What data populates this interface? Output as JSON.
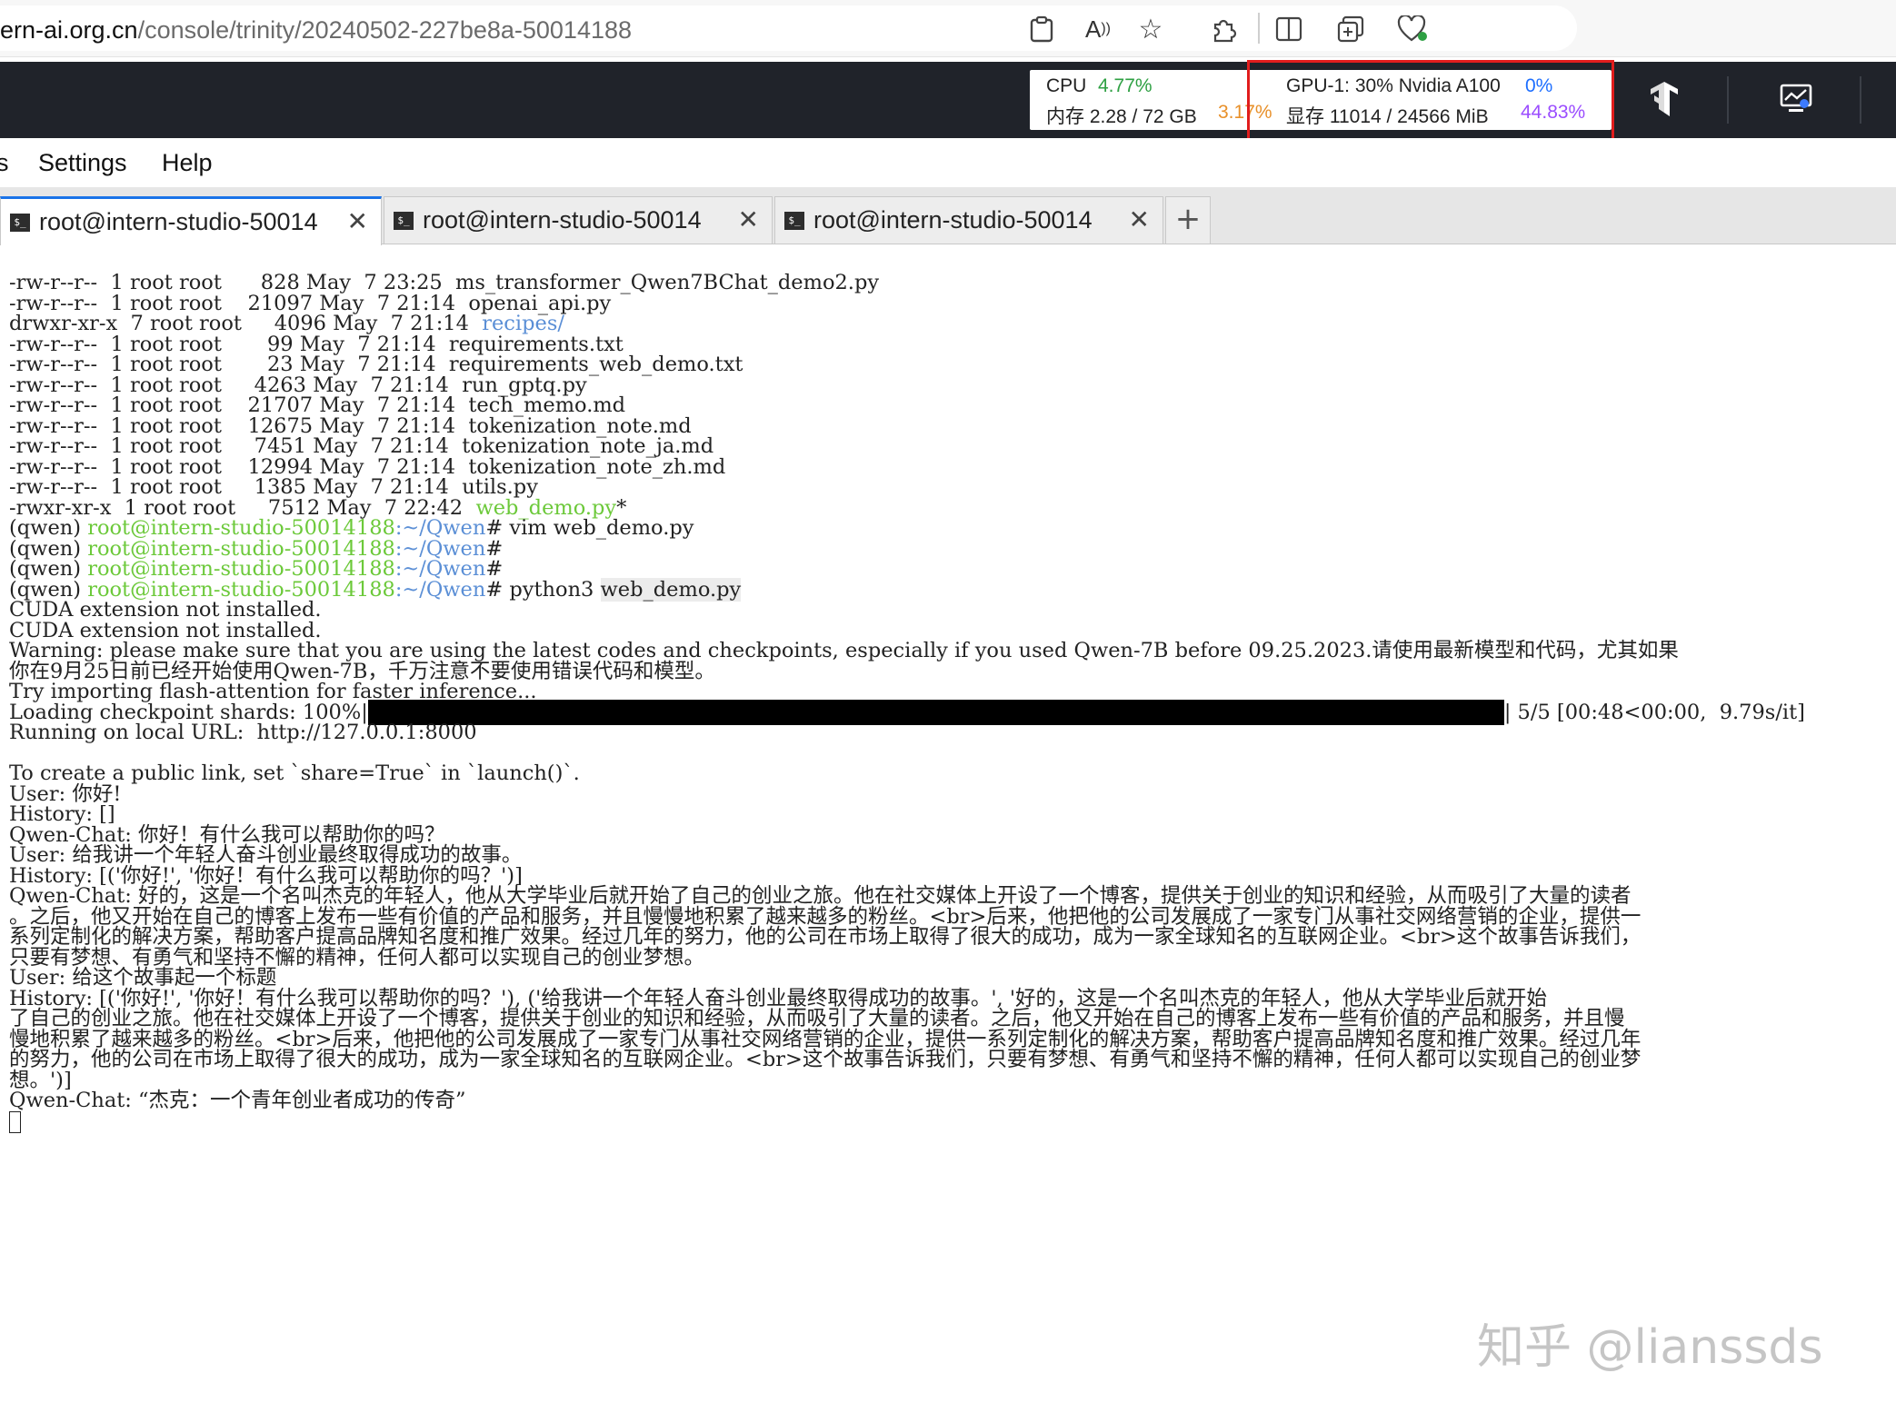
{
  "browser": {
    "url_host": "ern-ai.org.cn",
    "url_path": "/console/trinity/20240502-227be8a-50014188"
  },
  "header": {
    "cpu_label": "CPU",
    "cpu_value": "4.77%",
    "mem_label": "内存 2.28 / 72 GB",
    "mem_value": "3.17%",
    "gpu_label": "GPU-1: 30% Nvidia A100",
    "gpu_value": "0%",
    "vram_label": "显存 11014 / 24566 MiB",
    "vram_value": "44.83%"
  },
  "menubar": {
    "items": [
      "s",
      "Settings",
      "Help"
    ]
  },
  "tabs": [
    {
      "label": "root@intern-studio-50014",
      "active": true
    },
    {
      "label": "root@intern-studio-50014",
      "active": false
    },
    {
      "label": "root@intern-studio-50014",
      "active": false
    }
  ],
  "terminal": {
    "files": [
      {
        "perm": "-rw-r--r--",
        "links": "1",
        "owner": "root root",
        "size": "828",
        "month": "May",
        "day": "7",
        "time": "23:25",
        "name": "ms_transformer_Qwen7BChat_demo2.py",
        "kind": "file"
      },
      {
        "perm": "-rw-r--r--",
        "links": "1",
        "owner": "root root",
        "size": "21097",
        "month": "May",
        "day": "7",
        "time": "21:14",
        "name": "openai_api.py",
        "kind": "file"
      },
      {
        "perm": "drwxr-xr-x",
        "links": "7",
        "owner": "root root",
        "size": "4096",
        "month": "May",
        "day": "7",
        "time": "21:14",
        "name": "recipes/",
        "kind": "dir"
      },
      {
        "perm": "-rw-r--r--",
        "links": "1",
        "owner": "root root",
        "size": "99",
        "month": "May",
        "day": "7",
        "time": "21:14",
        "name": "requirements.txt",
        "kind": "file"
      },
      {
        "perm": "-rw-r--r--",
        "links": "1",
        "owner": "root root",
        "size": "23",
        "month": "May",
        "day": "7",
        "time": "21:14",
        "name": "requirements_web_demo.txt",
        "kind": "file"
      },
      {
        "perm": "-rw-r--r--",
        "links": "1",
        "owner": "root root",
        "size": "4263",
        "month": "May",
        "day": "7",
        "time": "21:14",
        "name": "run_gptq.py",
        "kind": "file"
      },
      {
        "perm": "-rw-r--r--",
        "links": "1",
        "owner": "root root",
        "size": "21707",
        "month": "May",
        "day": "7",
        "time": "21:14",
        "name": "tech_memo.md",
        "kind": "file"
      },
      {
        "perm": "-rw-r--r--",
        "links": "1",
        "owner": "root root",
        "size": "12675",
        "month": "May",
        "day": "7",
        "time": "21:14",
        "name": "tokenization_note.md",
        "kind": "file"
      },
      {
        "perm": "-rw-r--r--",
        "links": "1",
        "owner": "root root",
        "size": "7451",
        "month": "May",
        "day": "7",
        "time": "21:14",
        "name": "tokenization_note_ja.md",
        "kind": "file"
      },
      {
        "perm": "-rw-r--r--",
        "links": "1",
        "owner": "root root",
        "size": "12994",
        "month": "May",
        "day": "7",
        "time": "21:14",
        "name": "tokenization_note_zh.md",
        "kind": "file"
      },
      {
        "perm": "-rw-r--r--",
        "links": "1",
        "owner": "root root",
        "size": "1385",
        "month": "May",
        "day": "7",
        "time": "21:14",
        "name": "utils.py",
        "kind": "file"
      },
      {
        "perm": "-rwxr-xr-x",
        "links": "1",
        "owner": "root root",
        "size": "7512",
        "month": "May",
        "day": "7",
        "time": "22:42",
        "name": "web_demo.py",
        "kind": "exec",
        "suffix": "*"
      }
    ],
    "prompt_env": "(qwen) ",
    "prompt_user": "root@intern-studio-50014188",
    "prompt_path": ":~/Qwen",
    "prompt_hash": "#",
    "commands": [
      " vim web_demo.py",
      "",
      "",
      " python3 web_demo.py"
    ],
    "output": [
      "CUDA extension not installed.",
      "CUDA extension not installed.",
      "Warning: please make sure that you are using the latest codes and checkpoints, especially if you used Qwen-7B before 09.25.2023.请使用最新模型和代码，尤其如果",
      "你在9月25日前已经开始使用Qwen-7B，千万注意不要使用错误代码和模型。",
      "Try importing flash-attention for faster inference..."
    ],
    "loading_label": "Loading checkpoint shards: 100%|",
    "loading_progress": 1.0,
    "loading_tail": "| 5/5 [00:48<00:00,  9.79s/it]",
    "output2": [
      "Running on local URL:  http://127.0.0.1:8000",
      "",
      "To create a public link, set `share=True` in `launch()`.",
      "User: 你好!",
      "History: []",
      "Qwen-Chat: 你好！有什么我可以帮助你的吗？",
      "User: 给我讲一个年轻人奋斗创业最终取得成功的故事。",
      "History: [('你好!', '你好！有什么我可以帮助你的吗？')]",
      "Qwen-Chat: 好的，这是一个名叫杰克的年轻人，他从大学毕业后就开始了自己的创业之旅。他在社交媒体上开设了一个博客，提供关于创业的知识和经验，从而吸引了大量的读者",
      "。之后，他又开始在自己的博客上发布一些有价值的产品和服务，并且慢慢地积累了越来越多的粉丝。<br>后来，他把他的公司发展成了一家专门从事社交网络营销的企业，提供一",
      "系列定制化的解决方案，帮助客户提高品牌知名度和推广效果。经过几年的努力，他的公司在市场上取得了很大的成功，成为一家全球知名的互联网企业。<br>这个故事告诉我们，",
      "只要有梦想、有勇气和坚持不懈的精神，任何人都可以实现自己的创业梦想。",
      "User: 给这个故事起一个标题",
      "History: [('你好!', '你好！有什么我可以帮助你的吗？'), ('给我讲一个年轻人奋斗创业最终取得成功的故事。', '好的，这是一个名叫杰克的年轻人，他从大学毕业后就开始",
      "了自己的创业之旅。他在社交媒体上开设了一个博客，提供关于创业的知识和经验，从而吸引了大量的读者。之后，他又开始在自己的博客上发布一些有价值的产品和服务，并且慢",
      "慢地积累了越来越多的粉丝。<br>后来，他把他的公司发展成了一家专门从事社交网络营销的企业，提供一系列定制化的解决方案，帮助客户提高品牌知名度和推广效果。经过几年",
      "的努力，他的公司在市场上取得了很大的成功，成为一家全球知名的互联网企业。<br>这个故事告诉我们，只要有梦想、有勇气和坚持不懈的精神，任何人都可以实现自己的创业梦",
      "想。')]",
      "Qwen-Chat: “杰克：一个青年创业者成功的传奇”"
    ]
  },
  "watermark": "知乎 @lianssds",
  "icons": [
    "clipboard-icon",
    "read-aloud-icon",
    "favorite-star-icon",
    "extensions-icon",
    "split-screen-icon",
    "collections-icon",
    "browser-essentials-icon",
    "tensorboard-icon",
    "monitor-icon",
    "terminal-tab-icon",
    "close-icon",
    "plus-icon"
  ],
  "colors": {
    "header_bg": "#20232a",
    "prompt_green": "#6cc93a",
    "path_blue": "#5b8fd6",
    "highlight_red": "#e11d1d",
    "tab_accent": "#1a73e8"
  }
}
